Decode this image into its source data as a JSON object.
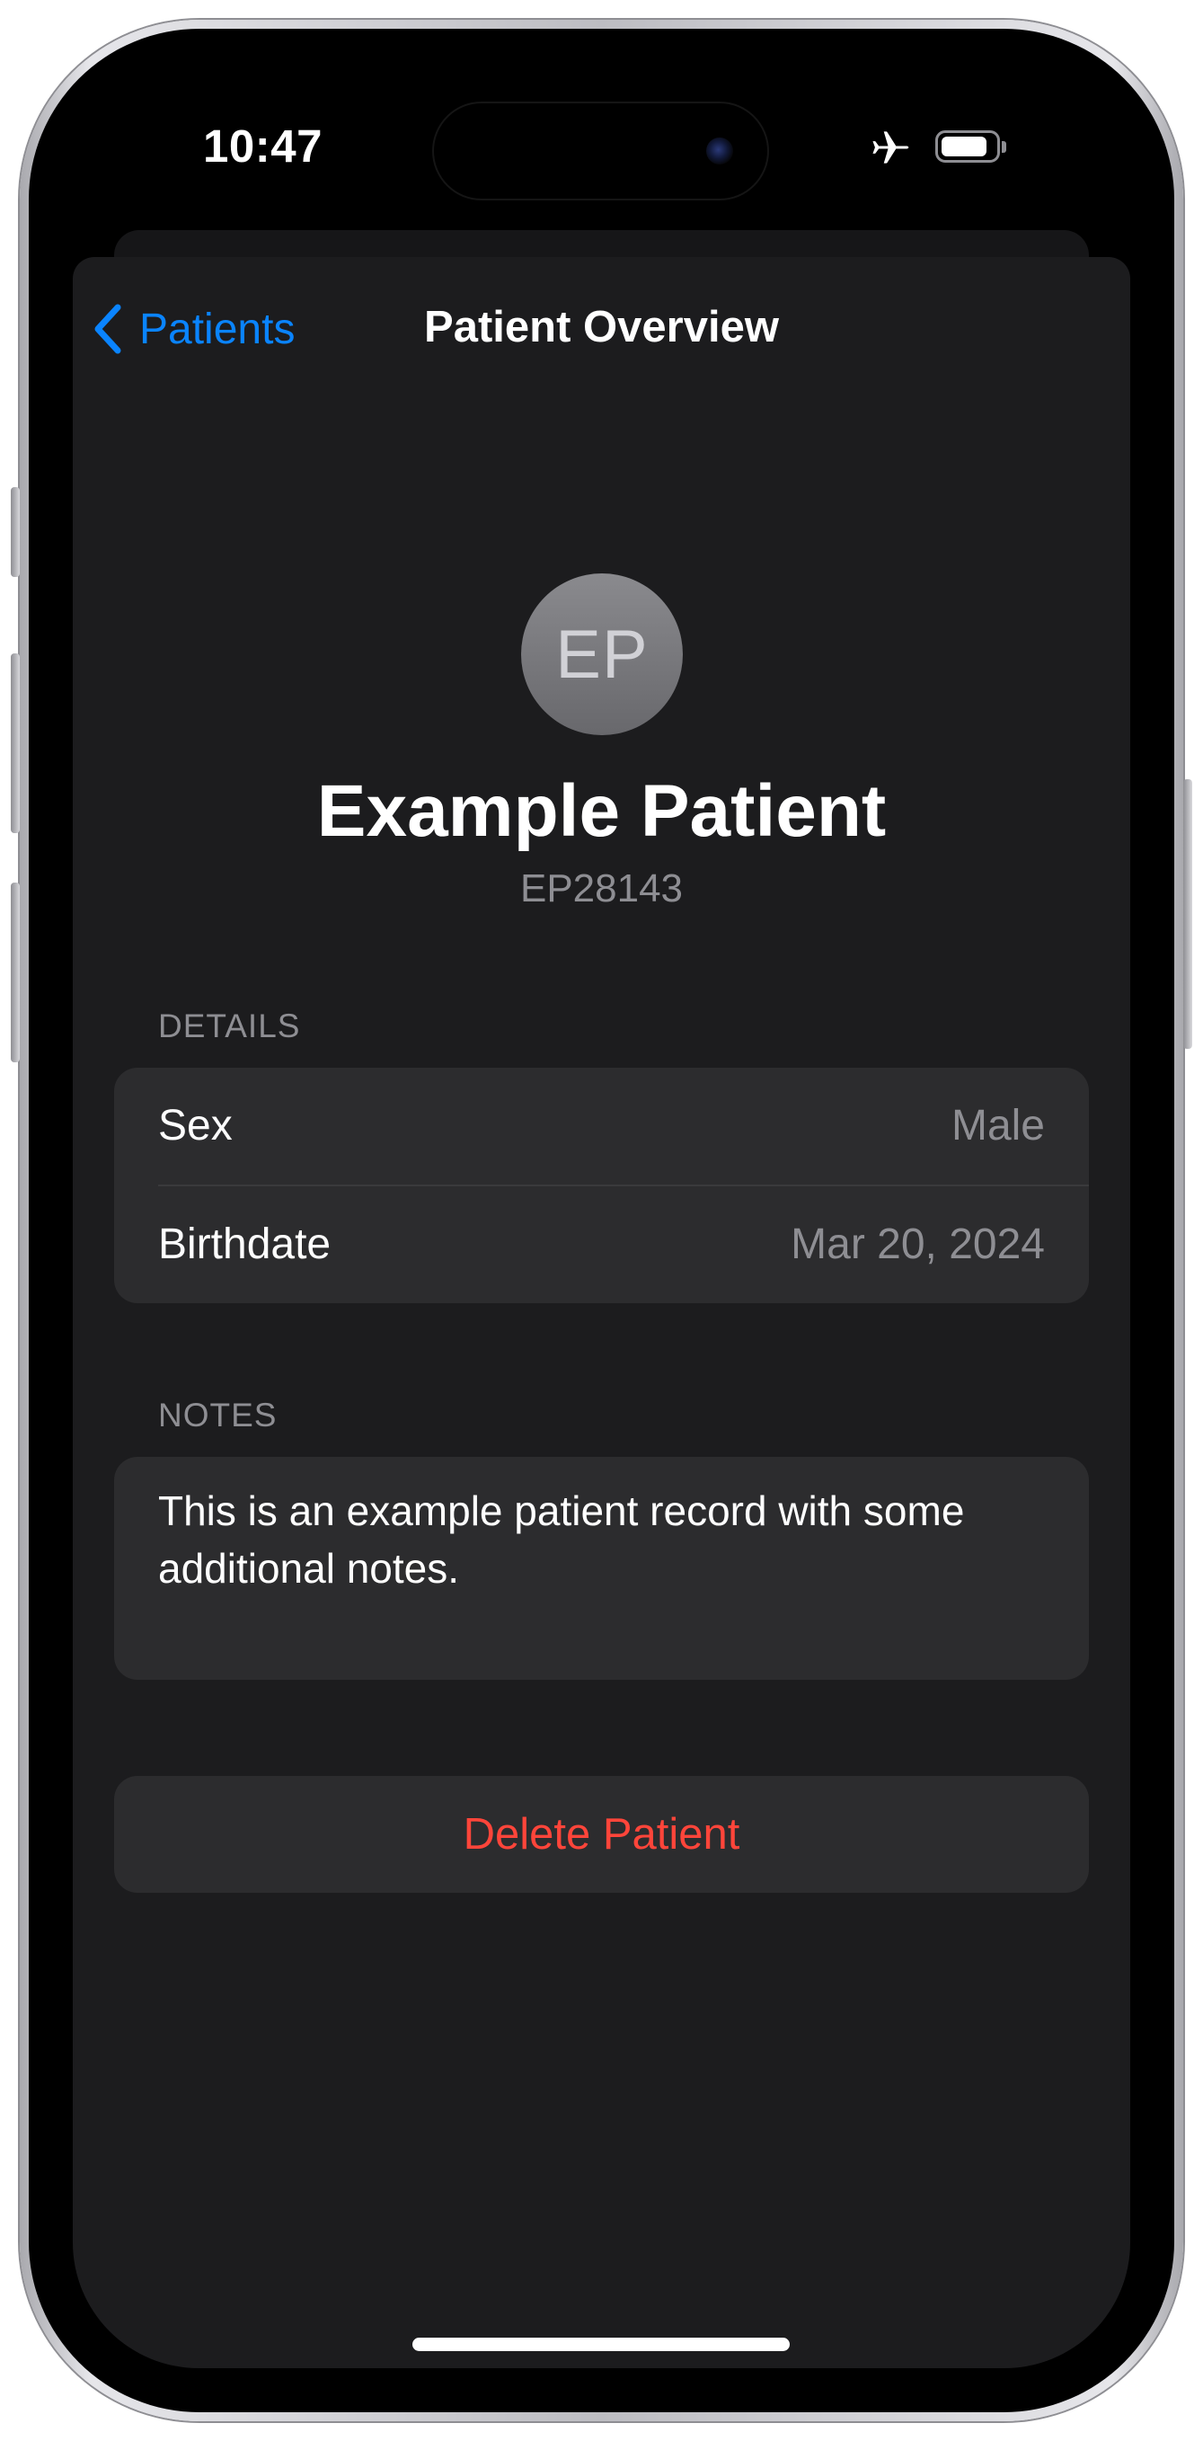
{
  "status_bar": {
    "time": "10:47",
    "icons": [
      "airplane-icon",
      "battery-icon"
    ]
  },
  "navbar": {
    "back_label": "Patients",
    "title": "Patient Overview"
  },
  "patient": {
    "initials": "EP",
    "name": "Example Patient",
    "id": "EP28143"
  },
  "details": {
    "header": "DETAILS",
    "rows": [
      {
        "label": "Sex",
        "value": "Male"
      },
      {
        "label": "Birthdate",
        "value": "Mar 20, 2024"
      }
    ]
  },
  "notes": {
    "header": "NOTES",
    "text": "This is an example patient record with some additional notes."
  },
  "actions": {
    "delete_label": "Delete Patient"
  },
  "colors": {
    "accent": "#0a84ff",
    "destructive": "#ff453a",
    "background": "#1c1c1e",
    "grouped_cell": "#2c2c2e",
    "secondary_text": "#8e8e93"
  }
}
